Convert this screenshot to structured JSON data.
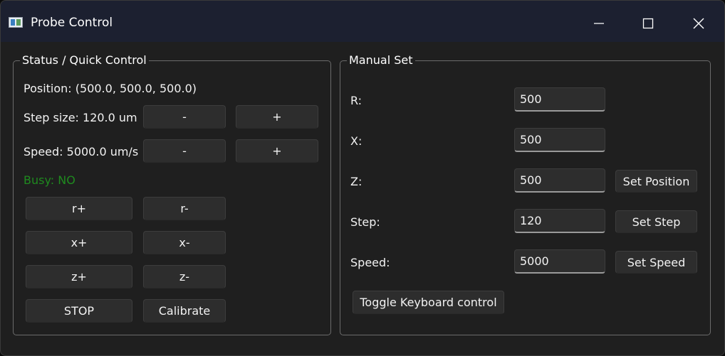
{
  "window": {
    "title": "Probe Control",
    "icon": "app-window-icon"
  },
  "titlebar_buttons": [
    "minimize-icon",
    "maximize-icon",
    "close-icon"
  ],
  "status": {
    "legend": "Status / Quick Control",
    "position": "Position: (500.0, 500.0, 500.0)",
    "step_size": "Step size: 120.0 um",
    "speed": "Speed: 5000.0 um/s",
    "busy": "Busy: NO",
    "busy_color": "#1f8a1f",
    "step_minus": "-",
    "step_plus": "+",
    "speed_minus": "-",
    "speed_plus": "+",
    "r_plus": "r+",
    "r_minus": "r-",
    "x_plus": "x+",
    "x_minus": "x-",
    "z_plus": "z+",
    "z_minus": "z-",
    "stop": "STOP",
    "calibrate": "Calibrate"
  },
  "manual": {
    "legend": "Manual Set",
    "r_label": "R:",
    "r_value": "500",
    "x_label": "X:",
    "x_value": "500",
    "z_label": "Z:",
    "z_value": "500",
    "step_label": "Step:",
    "step_value": "120",
    "speed_label": "Speed:",
    "speed_value": "5000",
    "set_position": "Set Position",
    "set_step": "Set Step",
    "set_speed": "Set Speed",
    "toggle_keyboard": "Toggle Keyboard control"
  }
}
